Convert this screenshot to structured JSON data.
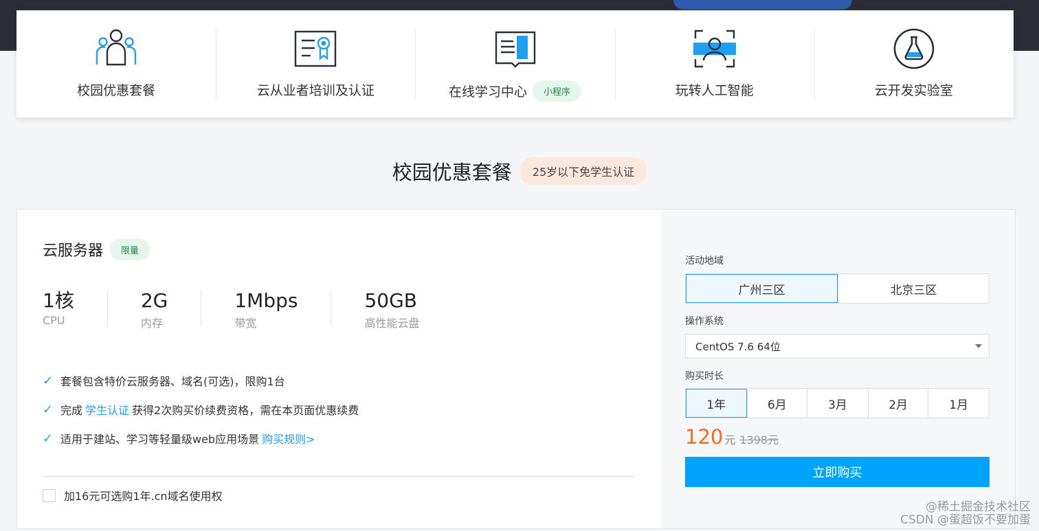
{
  "nav": {
    "items": [
      {
        "label": "校园优惠套餐",
        "icon": "users-group-icon"
      },
      {
        "label": "云从业者培训及认证",
        "icon": "certificate-icon"
      },
      {
        "label": "在线学习中心",
        "icon": "book-icon",
        "badge": "小程序"
      },
      {
        "label": "玩转人工智能",
        "icon": "face-scan-icon"
      },
      {
        "label": "云开发实验室",
        "icon": "flask-icon"
      }
    ]
  },
  "section": {
    "title": "校园优惠套餐",
    "badge": "25岁以下免学生认证"
  },
  "product": {
    "title": "云服务器",
    "badge": "限量",
    "specs": [
      {
        "value": "1核",
        "label": "CPU"
      },
      {
        "value": "2G",
        "label": "内存"
      },
      {
        "value": "1Mbps",
        "label": "带宽"
      },
      {
        "value": "50GB",
        "label": "高性能云盘"
      }
    ],
    "features": {
      "f1": "套餐包含特价云服务器、域名(可选)，限购1台",
      "f2_pre": "完成",
      "f2_link": "学生认证",
      "f2_post": "获得2次购买价续费资格，需在本页面优惠续费",
      "f3_pre": "适用于建站、学习等轻量级web应用场景",
      "f3_link": "购买规则>"
    },
    "addon": "加16元可选购1年.cn域名使用权"
  },
  "purchase": {
    "region_label": "活动地域",
    "regions": [
      "广州三区",
      "北京三区"
    ],
    "region_selected": "广州三区",
    "os_label": "操作系统",
    "os_value": "CentOS 7.6 64位",
    "duration_label": "购买时长",
    "durations": [
      "1年",
      "6月",
      "3月",
      "2月",
      "1月"
    ],
    "duration_selected": "1年",
    "price": "120",
    "price_unit": "元",
    "original_price": "1398元",
    "buy_label": "立即购买"
  },
  "watermark": {
    "line1": "@稀土掘金技术社区",
    "line2": "CSDN @蛋超饭不要加蛋"
  },
  "colors": {
    "accent": "#1e9ff2",
    "buy_button": "#00a4ff",
    "price": "#f36a1c",
    "badge_green_bg": "#e7f6ec",
    "badge_green_text": "#1c8b3c"
  }
}
